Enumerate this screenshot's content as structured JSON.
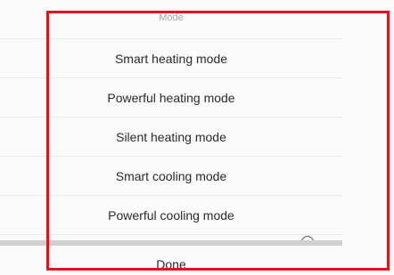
{
  "picker": {
    "title": "Mode",
    "options": [
      {
        "label": "Smart heating mode"
      },
      {
        "label": "Powerful heating mode"
      },
      {
        "label": "Silent heating mode"
      },
      {
        "label": "Smart cooling mode"
      },
      {
        "label": "Powerful cooling mode"
      }
    ],
    "done_label": "Done"
  },
  "colors": {
    "highlight_frame": "#e2131c",
    "sheet_background": "#fbfbfb",
    "divider_band": "#cfcfcf",
    "title_text": "#a6a6a6",
    "option_text": "#2a2a2a"
  }
}
